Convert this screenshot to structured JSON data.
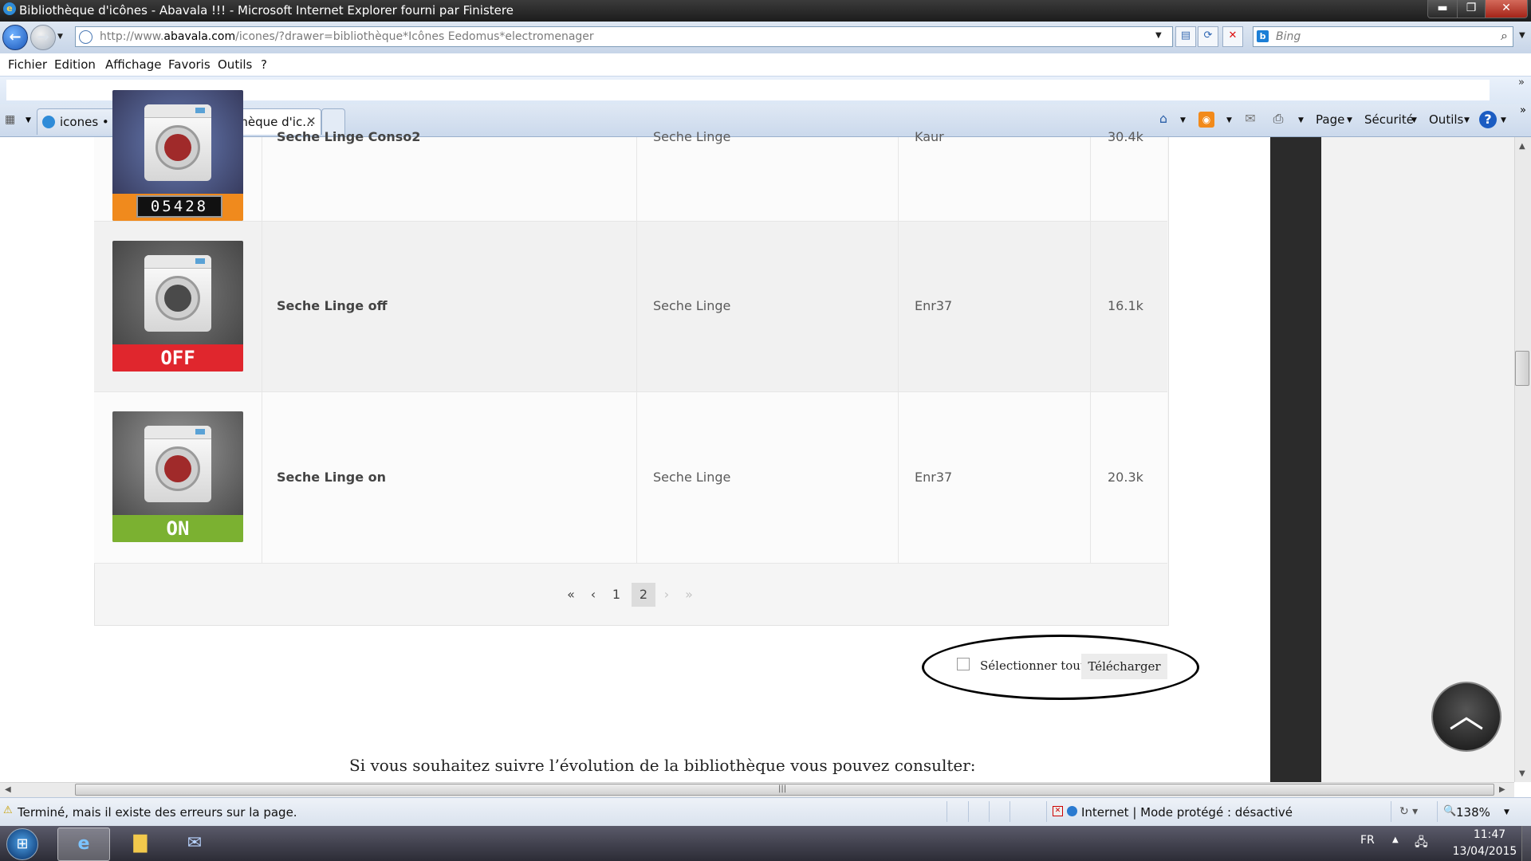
{
  "window": {
    "title": "Bibliothèque d'icônes - Abavala !!! - Microsoft Internet Explorer fourni par Finistere",
    "minimize": "▬",
    "maximize": "❐",
    "close": "✕"
  },
  "address": {
    "url_prefix": "http://www.",
    "url_domain": "abavala.com",
    "url_suffix": "/icones/?drawer=bibliothèque*Icônes Eedomus*electromenager",
    "search_placeholder": "Bing"
  },
  "menu": [
    "Fichier",
    "Edition",
    "Affichage",
    "Favoris",
    "Outils",
    "?"
  ],
  "tabs": [
    {
      "label": "icones • Portail web...",
      "active": false
    },
    {
      "label": "Bibliothèque d'ic...",
      "active": true
    }
  ],
  "command_bar": {
    "page": "Page",
    "security": "Sécurité",
    "tools": "Outils",
    "help": "?"
  },
  "table": {
    "rows": [
      {
        "name": "Seche Linge Conso2",
        "category": "Seche Linge",
        "author": "Kaur",
        "size": "30.4k",
        "thumb_label": "",
        "counter": "05428",
        "status_color": "#f08a1d",
        "glass_color": "#a02a2a",
        "partial": true
      },
      {
        "name": "Seche Linge off",
        "category": "Seche Linge",
        "author": "Enr37",
        "size": "16.1k",
        "thumb_label": "OFF",
        "counter": "",
        "status_color": "#e0262d",
        "glass_color": "#4a4a4a",
        "partial": false
      },
      {
        "name": "Seche Linge on",
        "category": "Seche Linge",
        "author": "Enr37",
        "size": "20.3k",
        "thumb_label": "ON",
        "counter": "",
        "status_color": "#7bb131",
        "glass_color": "#a02a2a",
        "partial": false
      }
    ]
  },
  "pagination": {
    "first": "«",
    "prev": "‹",
    "pages": [
      "1",
      "2"
    ],
    "current": "2",
    "next": "›",
    "last": "»"
  },
  "actions": {
    "select_all": "Sélectionner tout",
    "download": "Télécharger"
  },
  "follow_text": "Si vous souhaitez suivre l’évolution de la bibliothèque vous pouvez consulter:",
  "status": {
    "message": "Terminé, mais il existe des erreurs sur la page.",
    "zone": "Internet | Mode protégé : désactivé",
    "zoom": "138%"
  },
  "taskbar": {
    "language": "FR",
    "time": "11:47",
    "date": "13/04/2015"
  }
}
